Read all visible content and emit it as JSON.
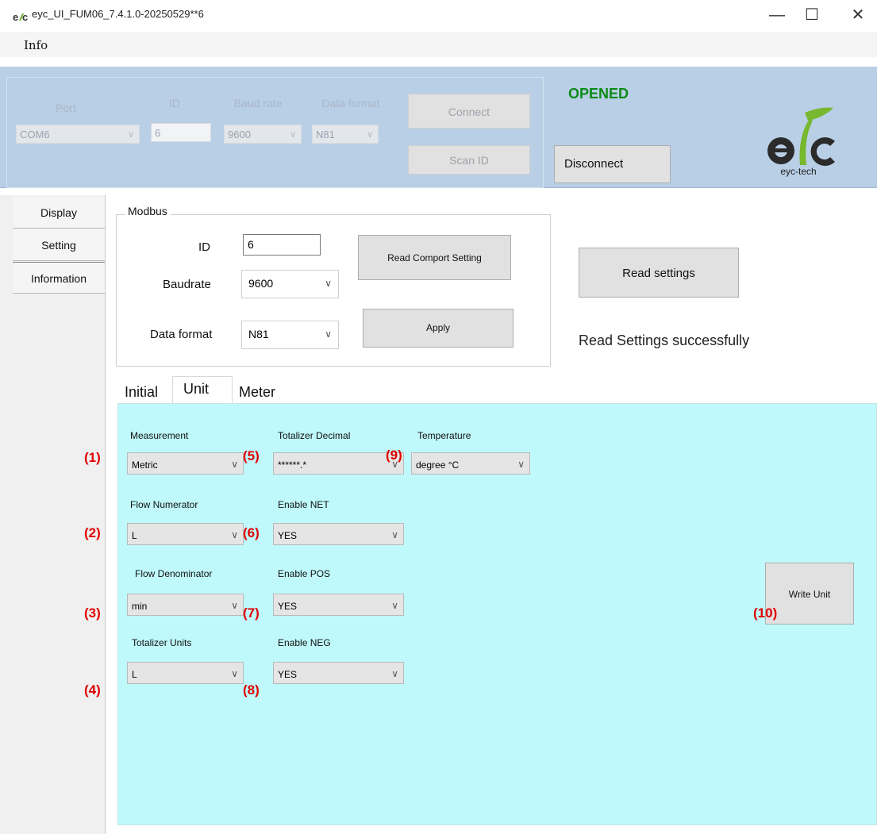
{
  "window": {
    "title": "eyc_UI_FUM06_7.4.1.0-20250529**6",
    "minimize": "—",
    "maximize": "☐",
    "close": "✕"
  },
  "menu": {
    "info": "Info"
  },
  "connection": {
    "port_label": "Port",
    "port_value": "COM6",
    "id_label": "ID",
    "id_value": "6",
    "baud_label": "Baud rate",
    "baud_value": "9600",
    "format_label": "Data format",
    "format_value": "N81",
    "connect_label": "Connect",
    "scan_label": "Scan ID",
    "status": "OPENED",
    "disconnect_label": "Disconnect",
    "logo_text": "eyc-tech",
    "status_color": "#0c8a18"
  },
  "nav": {
    "items": [
      "Display",
      "Setting",
      "Information"
    ]
  },
  "modbus": {
    "legend": "Modbus",
    "id_label": "ID",
    "id_value": "6",
    "baud_label": "Baudrate",
    "baud_value": "9600",
    "format_label": "Data format",
    "format_value": "N81",
    "read_comport_label": "Read Comport Setting",
    "apply_label": "Apply"
  },
  "read_settings": {
    "button": "Read settings",
    "message": "Read Settings successfully"
  },
  "tabs": [
    "Initial",
    "Unit",
    "Meter"
  ],
  "unit": {
    "measurement_label": "Measurement",
    "measurement_value": "Metric",
    "flow_num_label": "Flow Numerator",
    "flow_num_value": "L",
    "flow_den_label": "Flow Denominator",
    "flow_den_value": "min",
    "tot_units_label": "Totalizer Units",
    "tot_units_value": "L",
    "tot_decimal_label": "Totalizer Decimal",
    "tot_decimal_value": "******.*",
    "net_label": "Enable NET",
    "net_value": "YES",
    "pos_label": "Enable POS",
    "pos_value": "YES",
    "neg_label": "Enable NEG",
    "neg_value": "YES",
    "temp_label": "Temperature",
    "temp_value": "degree °C",
    "write_label": "Write Unit",
    "panel_color": "#bff9fb"
  },
  "markers": [
    "(1)",
    "(2)",
    "(3)",
    "(4)",
    "(5)",
    "(6)",
    "(7)",
    "(8)",
    "(9)",
    "(10)"
  ],
  "marker_color": "#e10000"
}
